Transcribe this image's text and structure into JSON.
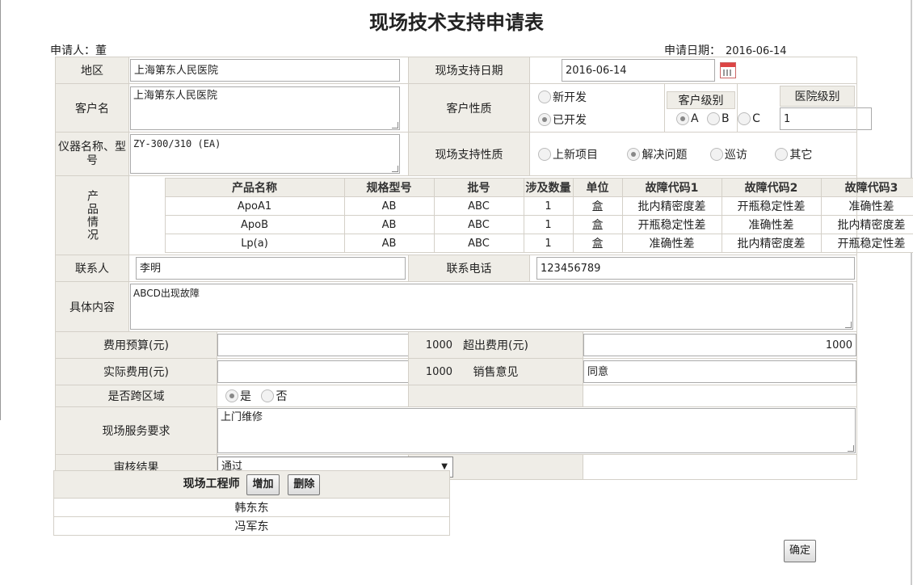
{
  "title": "现场技术支持申请表",
  "applicant": {
    "label": "申请人：",
    "value": "董"
  },
  "apply_date": {
    "label": "申请日期：",
    "value": "2016-06-14"
  },
  "labels": {
    "region": "地区",
    "support_date": "现场支持日期",
    "customer_name": "客户名",
    "customer_nature": "客户性质",
    "customer_level": "客户级别",
    "hospital_level": "医院级别",
    "instrument": "仪器名称、型号",
    "support_nature": "现场支持性质",
    "product_info": "产品情况",
    "contact": "联系人",
    "phone": "联系电话",
    "details": "具体内容",
    "budget": "费用预算(元)",
    "overrun": "超出费用(元)",
    "actual": "实际费用(元)",
    "sales_opinion": "销售意见",
    "cross_region": "是否跨区域",
    "service_req": "现场服务要求",
    "review": "审核结果"
  },
  "values": {
    "region": "上海第东人民医院",
    "support_date": "2016-06-14",
    "customer_name": "上海第东人民医院",
    "hospital_level": "1",
    "instrument": "ZY-300/310 (EA)",
    "contact": "李明",
    "phone": "123456789",
    "details": "ABCD出现故障",
    "budget": "1000",
    "overrun": "1000",
    "actual": "1000",
    "sales_opinion": "同意",
    "service_req": "上门维修",
    "review": "通过"
  },
  "customer_nature_options": [
    {
      "label": "新开发",
      "selected": false
    },
    {
      "label": "已开发",
      "selected": true
    }
  ],
  "customer_level_options": [
    {
      "label": "A",
      "selected": true
    },
    {
      "label": "B",
      "selected": false
    },
    {
      "label": "C",
      "selected": false
    }
  ],
  "support_nature_options": [
    {
      "label": "上新项目",
      "selected": false
    },
    {
      "label": "解决问题",
      "selected": true
    },
    {
      "label": "巡访",
      "selected": false
    },
    {
      "label": "其它",
      "selected": false
    }
  ],
  "cross_region_options": [
    {
      "label": "是",
      "selected": true
    },
    {
      "label": "否",
      "selected": false
    }
  ],
  "products": {
    "headers": [
      "产品名称",
      "规格型号",
      "批号",
      "涉及数量",
      "单位",
      "故障代码1",
      "故障代码2",
      "故障代码3"
    ],
    "rows": [
      [
        "ApoA1",
        "AB",
        "ABC",
        "1",
        "盒",
        "批内精密度差",
        "开瓶稳定性差",
        "准确性差"
      ],
      [
        "ApoB",
        "AB",
        "ABC",
        "1",
        "盒",
        "开瓶稳定性差",
        "准确性差",
        "批内精密度差"
      ],
      [
        "Lp(a)",
        "AB",
        "ABC",
        "1",
        "盒",
        "准确性差",
        "批内精密度差",
        "开瓶稳定性差"
      ]
    ]
  },
  "engineers": {
    "header": "现场工程师",
    "add_label": "增加",
    "delete_label": "删除",
    "list": [
      "韩东东",
      "冯军东"
    ]
  },
  "confirm_label": "确定",
  "calendar_icon": "calendar-icon"
}
